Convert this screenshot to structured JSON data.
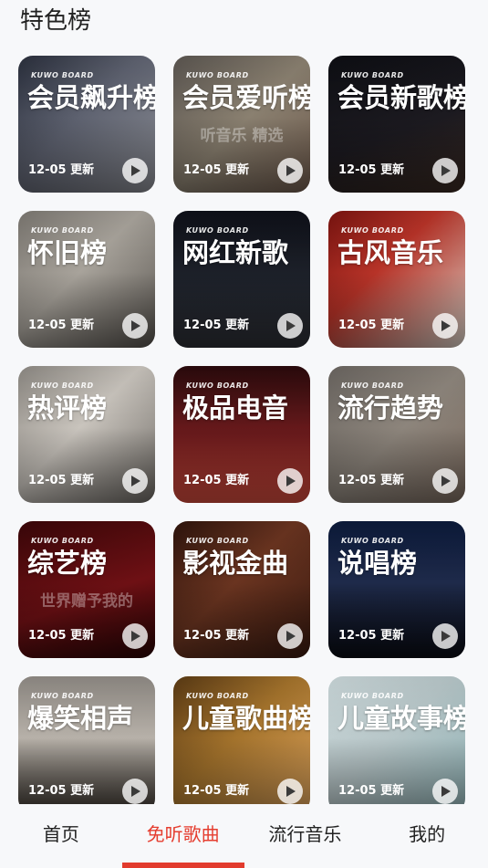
{
  "section": {
    "title": "特色榜"
  },
  "board_label": "KUWO BOARD",
  "cards": [
    {
      "name": "会员飙升榜",
      "date": "12-05 更新",
      "deco": "",
      "bg": "linear-gradient(135deg,#2a2f3c 0%,#5e6270 45%,#8a8c93 100%)"
    },
    {
      "name": "会员爱听榜",
      "date": "12-05 更新",
      "deco": "听音乐\n精选",
      "bg": "linear-gradient(135deg,#5a5550 0%,#8a8070 50%,#6e5a4c 100%)"
    },
    {
      "name": "会员新歌榜",
      "date": "12-05 更新",
      "deco": "",
      "bg": "linear-gradient(160deg,#0d0e13 0%,#1c1a20 55%,#3a2a22 100%)"
    },
    {
      "name": "怀旧榜",
      "date": "12-05 更新",
      "deco": "",
      "bg": "linear-gradient(135deg,#7a7670 0%,#a8a39b 45%,#55514c 100%)"
    },
    {
      "name": "网红新歌",
      "date": "12-05 更新",
      "deco": "",
      "bg": "linear-gradient(180deg,#0e1018 0%,#1f232c 55%,#2d2f35 100%)"
    },
    {
      "name": "古风音乐",
      "date": "12-05 更新",
      "deco": "",
      "bg": "linear-gradient(135deg,#7a1410 0%,#b73328 40%,#d8d0c6 100%)"
    },
    {
      "name": "热评榜",
      "date": "12-05 更新",
      "deco": "",
      "bg": "linear-gradient(135deg,#8c8882 0%,#c9c4bd 45%,#6b6762 100%)"
    },
    {
      "name": "极品电音",
      "date": "12-05 更新",
      "deco": "",
      "bg": "linear-gradient(180deg,#2a0a0c 0%,#6b1a1c 50%,#d14a3c 100%)"
    },
    {
      "name": "流行趋势",
      "date": "12-05 更新",
      "deco": "",
      "bg": "linear-gradient(135deg,#6a6560 0%,#8d857c 50%,#7a6a5e 100%)"
    },
    {
      "name": "综艺榜",
      "date": "12-05 更新",
      "deco": "世界赠予我的",
      "bg": "linear-gradient(160deg,#3a0608 0%,#6e1014 55%,#2a0404 100%)"
    },
    {
      "name": "影视金曲",
      "date": "12-05 更新",
      "deco": "",
      "bg": "linear-gradient(135deg,#2e140c 0%,#6a3420 45%,#3a1a10 100%)"
    },
    {
      "name": "说唱榜",
      "date": "12-05 更新",
      "deco": "",
      "bg": "linear-gradient(180deg,#0c1a3a 0%,#1e2a4a 45%,#0a0c14 100%)"
    },
    {
      "name": "爆笑相声",
      "date": "12-05 更新",
      "deco": "",
      "bg": "linear-gradient(180deg,#8f8a84 0%,#b7b1a9 45%,#3c3630 100%)"
    },
    {
      "name": "儿童歌曲榜",
      "date": "12-05 更新",
      "deco": "",
      "bg": "linear-gradient(135deg,#5a3a14 0%,#a4732c 45%,#d9a05a 100%)"
    },
    {
      "name": "儿童故事榜",
      "date": "12-05 更新",
      "deco": "",
      "bg": "linear-gradient(135deg,#c9d6d8 0%,#b7c6c8 45%,#8fb1b4 100%)"
    }
  ],
  "tabs": [
    {
      "label": "首页",
      "active": false
    },
    {
      "label": "免听歌曲",
      "active": true
    },
    {
      "label": "流行音乐",
      "active": false
    },
    {
      "label": "我的",
      "active": false
    }
  ],
  "colors": {
    "accent": "#e53d2f",
    "background": "#f7f8fa"
  }
}
